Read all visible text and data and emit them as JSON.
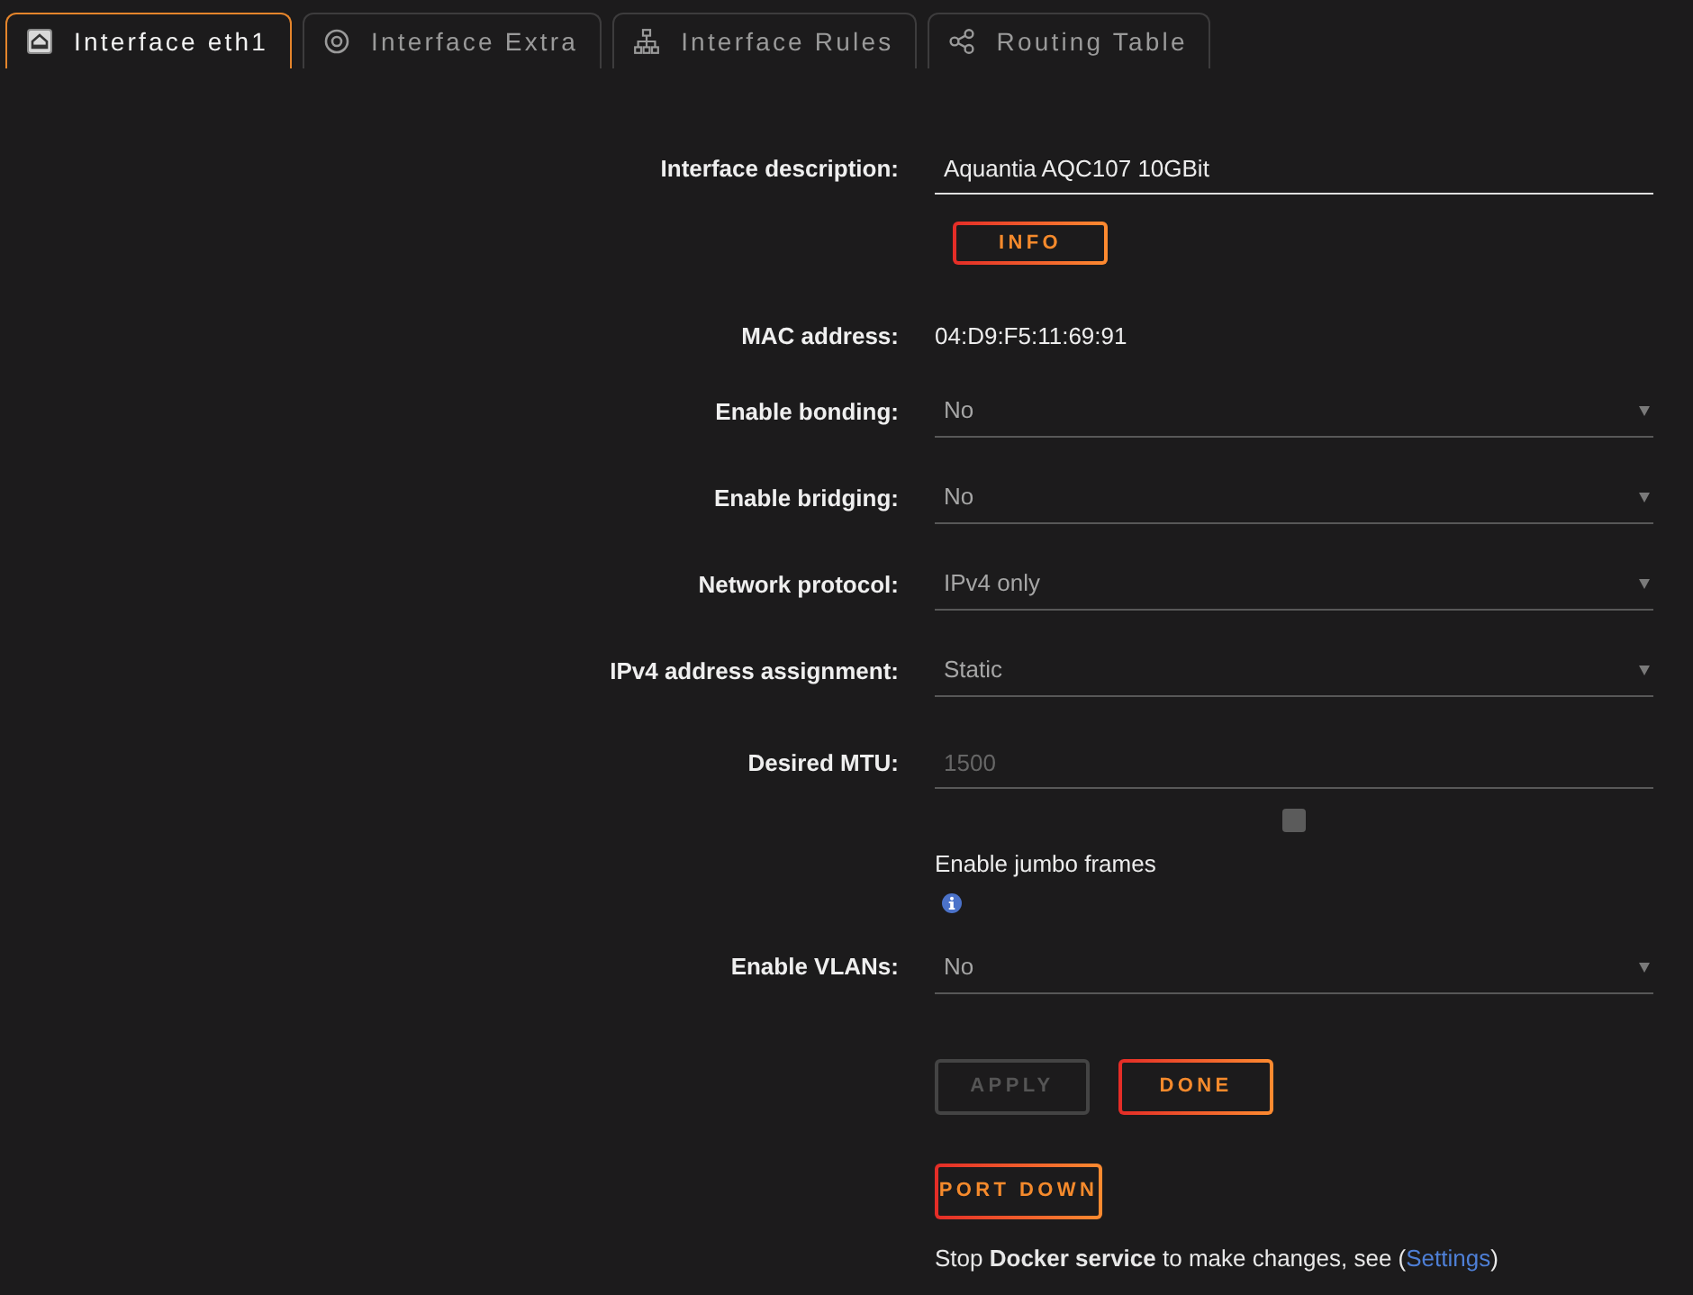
{
  "tabs": [
    {
      "label": "Interface eth1",
      "kind": "interface",
      "selected": true
    },
    {
      "label": "Interface Extra",
      "kind": "extra",
      "selected": false
    },
    {
      "label": "Interface Rules",
      "kind": "rules",
      "selected": false
    },
    {
      "label": "Routing Table",
      "kind": "routing",
      "selected": false
    }
  ],
  "form": {
    "rows": [
      {
        "kind": "input",
        "label": "Interface description:",
        "value": "Aquantia AQC107 10GBit",
        "focused": true
      },
      {
        "kind": "info",
        "buttons": [
          {
            "label": "INFO",
            "disabled": false
          }
        ]
      },
      {
        "kind": "static",
        "label": "MAC address:",
        "value": "04:D9:F5:11:69:91"
      },
      {
        "kind": "select",
        "label": "Enable bonding:",
        "value": "No"
      },
      {
        "kind": "select",
        "label": "Enable bridging:",
        "value": "No"
      },
      {
        "kind": "select",
        "label": "Network protocol:",
        "value": "IPv4 only"
      },
      {
        "kind": "select",
        "label": "IPv4 address assignment:",
        "value": "Static"
      },
      {
        "kind": "input",
        "label": "Desired MTU:",
        "placeholder": "1500",
        "focused": false
      },
      {
        "kind": "checkbox",
        "text": "Enable jumbo frames",
        "checked": false
      },
      {
        "kind": "select",
        "label": "Enable VLANs:",
        "value": "No"
      },
      {
        "kind": "buttons",
        "buttons": [
          {
            "label": "APPLY",
            "disabled": true
          },
          {
            "label": "DONE",
            "disabled": false
          }
        ]
      },
      {
        "kind": "buttons",
        "buttons": [
          {
            "label": "PORT DOWN",
            "disabled": false
          }
        ]
      },
      {
        "kind": "note",
        "text": "Stop **Docker service** to make changes, see (",
        "link": "Settings",
        "text_after": ")"
      }
    ]
  }
}
